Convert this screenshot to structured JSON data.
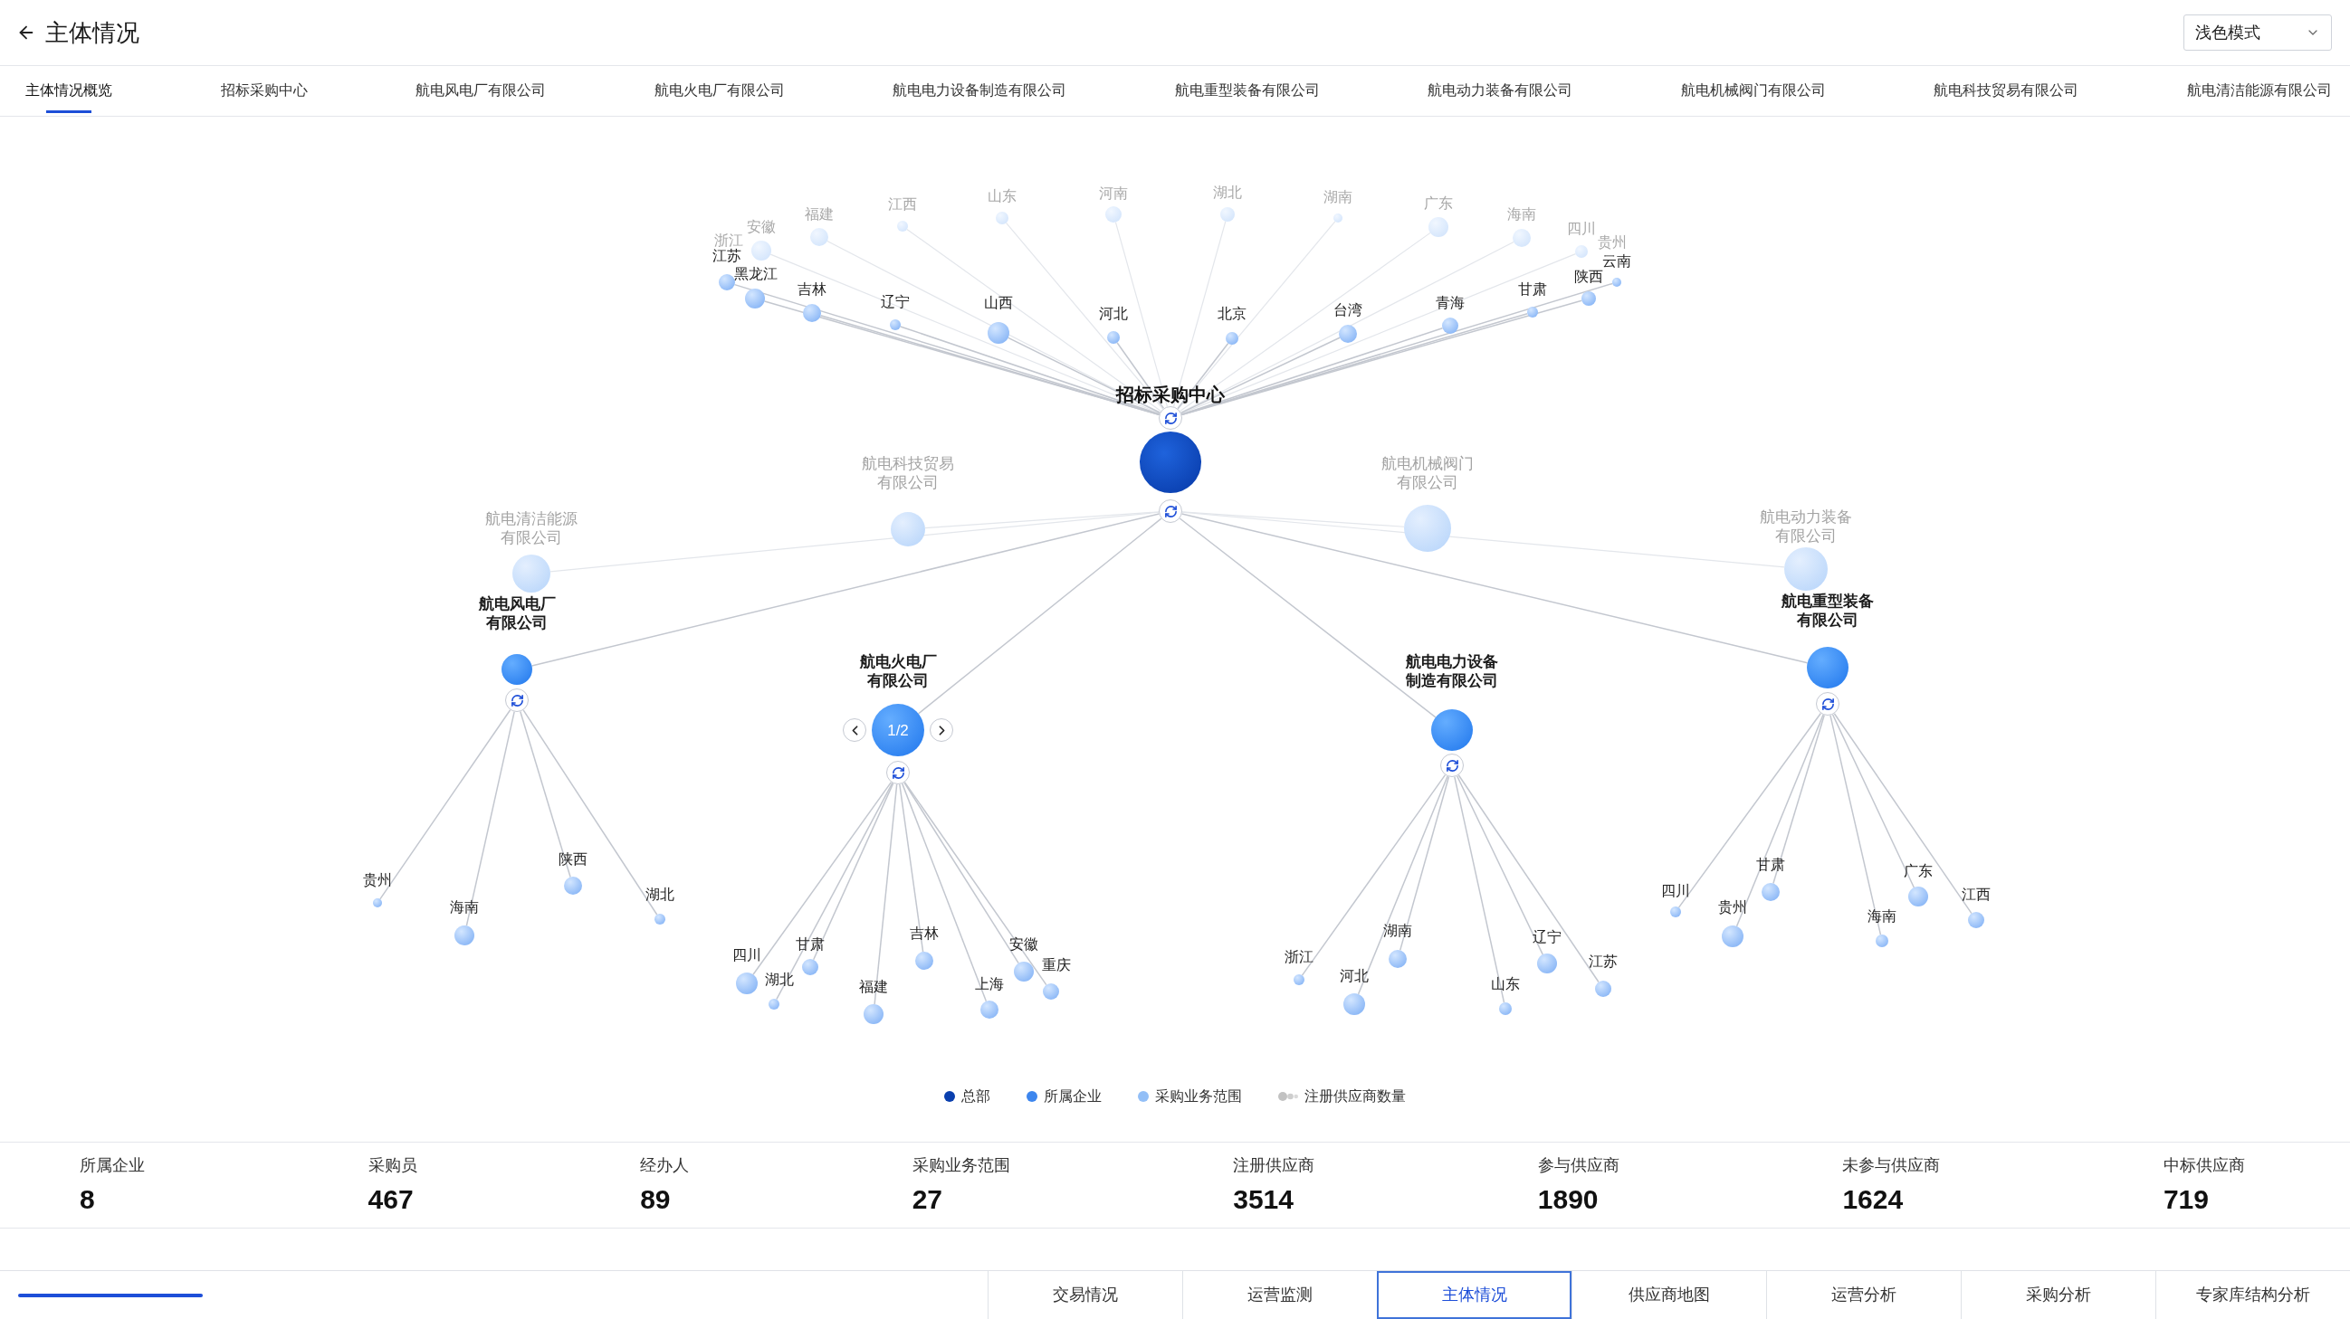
{
  "header": {
    "title": "主体情况",
    "theme_select": "浅色模式"
  },
  "tabs": [
    {
      "label": "主体情况概览",
      "selected": true
    },
    {
      "label": "招标采购中心",
      "selected": false
    },
    {
      "label": "航电风电厂有限公司",
      "selected": false
    },
    {
      "label": "航电火电厂有限公司",
      "selected": false
    },
    {
      "label": "航电电力设备制造有限公司",
      "selected": false
    },
    {
      "label": "航电重型装备有限公司",
      "selected": false
    },
    {
      "label": "航电动力装备有限公司",
      "selected": false
    },
    {
      "label": "航电机械阀门有限公司",
      "selected": false
    },
    {
      "label": "航电科技贸易有限公司",
      "selected": false
    },
    {
      "label": "航电清洁能源有限公司",
      "selected": false
    }
  ],
  "graph": {
    "hub": {
      "label": "招标采购中心"
    },
    "provinces": [
      {
        "label": "浙江",
        "faded": true
      },
      {
        "label": "安徽",
        "faded": true
      },
      {
        "label": "福建",
        "faded": true
      },
      {
        "label": "江西",
        "faded": true
      },
      {
        "label": "山东",
        "faded": true
      },
      {
        "label": "河南",
        "faded": true
      },
      {
        "label": "湖北",
        "faded": true
      },
      {
        "label": "湖南",
        "faded": true
      },
      {
        "label": "广东",
        "faded": true
      },
      {
        "label": "海南",
        "faded": true
      },
      {
        "label": "四川",
        "faded": true
      },
      {
        "label": "贵州",
        "faded": true
      },
      {
        "label": "江苏",
        "faded": false
      },
      {
        "label": "黑龙江",
        "faded": false
      },
      {
        "label": "吉林",
        "faded": false
      },
      {
        "label": "辽宁",
        "faded": false
      },
      {
        "label": "山西",
        "faded": false
      },
      {
        "label": "河北",
        "faded": false
      },
      {
        "label": "北京",
        "faded": false
      },
      {
        "label": "台湾",
        "faded": false
      },
      {
        "label": "青海",
        "faded": false
      },
      {
        "label": "甘肃",
        "faded": false
      },
      {
        "label": "陕西",
        "faded": false
      },
      {
        "label": "云南",
        "faded": false
      }
    ],
    "companies": [
      {
        "label_lines": [
          "航电清洁能源",
          "有限公司"
        ],
        "faded": true
      },
      {
        "label_lines": [
          "航电科技贸易",
          "有限公司"
        ],
        "faded": true
      },
      {
        "label_lines": [
          "航电机械阀门",
          "有限公司"
        ],
        "faded": true
      },
      {
        "label_lines": [
          "航电动力装备",
          "有限公司"
        ],
        "faded": true
      },
      {
        "label_lines": [
          "航电风电厂",
          "有限公司"
        ],
        "faded": false,
        "leaves": [
          {
            "label": "贵州"
          },
          {
            "label": "海南"
          },
          {
            "label": "陕西"
          },
          {
            "label": "湖北"
          }
        ]
      },
      {
        "label_lines": [
          "航电火电厂",
          "有限公司"
        ],
        "faded": false,
        "pager": "1/2",
        "leaves": [
          {
            "label": "四川"
          },
          {
            "label": "湖北"
          },
          {
            "label": "甘肃"
          },
          {
            "label": "福建"
          },
          {
            "label": "吉林"
          },
          {
            "label": "上海"
          },
          {
            "label": "安徽"
          },
          {
            "label": "重庆"
          }
        ]
      },
      {
        "label_lines": [
          "航电电力设备",
          "制造有限公司"
        ],
        "faded": false,
        "leaves": [
          {
            "label": "浙江"
          },
          {
            "label": "河北"
          },
          {
            "label": "湖南"
          },
          {
            "label": "山东"
          },
          {
            "label": "辽宁"
          },
          {
            "label": "江苏"
          }
        ]
      },
      {
        "label_lines": [
          "航电重型装备",
          "有限公司"
        ],
        "faded": false,
        "leaves": [
          {
            "label": "四川"
          },
          {
            "label": "贵州"
          },
          {
            "label": "甘肃"
          },
          {
            "label": "海南"
          },
          {
            "label": "广东"
          },
          {
            "label": "江西"
          }
        ]
      }
    ],
    "legend": [
      {
        "label": "总部",
        "kind": "hub"
      },
      {
        "label": "所属企业",
        "kind": "company"
      },
      {
        "label": "采购业务范围",
        "kind": "region"
      },
      {
        "label": "注册供应商数量",
        "kind": "supplier"
      }
    ]
  },
  "stats": [
    {
      "label": "所属企业",
      "value": "8"
    },
    {
      "label": "采购员",
      "value": "467"
    },
    {
      "label": "经办人",
      "value": "89"
    },
    {
      "label": "采购业务范围",
      "value": "27"
    },
    {
      "label": "注册供应商",
      "value": "3514"
    },
    {
      "label": "参与供应商",
      "value": "1890"
    },
    {
      "label": "未参与供应商",
      "value": "1624"
    },
    {
      "label": "中标供应商",
      "value": "719"
    }
  ],
  "bottom_tabs": [
    {
      "label": "交易情况",
      "selected": false
    },
    {
      "label": "运营监测",
      "selected": false
    },
    {
      "label": "主体情况",
      "selected": true
    },
    {
      "label": "供应商地图",
      "selected": false
    },
    {
      "label": "运营分析",
      "selected": false
    },
    {
      "label": "采购分析",
      "selected": false
    },
    {
      "label": "专家库结构分析",
      "selected": false
    }
  ]
}
